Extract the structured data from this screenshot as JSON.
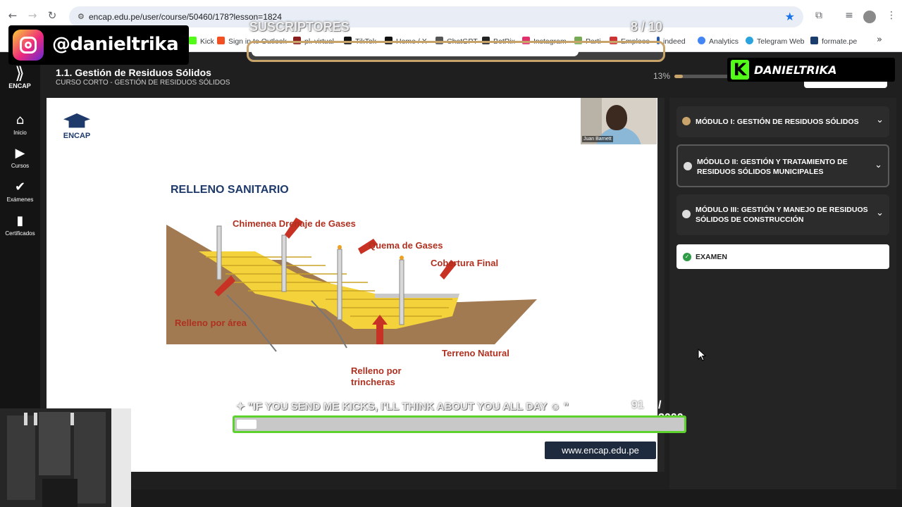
{
  "browser": {
    "url": "encap.edu.pe/user/course/50460/178?lesson=1824",
    "bookmarks": [
      "Kick",
      "Sign in to Outlook",
      "pl. virtual",
      "TikTok",
      "Home / X",
      "ChatGPT",
      "BotRix",
      "Instagram",
      "Parti",
      "Empleos",
      "indeed",
      "Analytics",
      "Telegram Web",
      "formate.pe"
    ]
  },
  "overlays": {
    "instagram_handle": "@danieltrika",
    "subs_label": "SUSCRIPTORES",
    "subs_count": "8 / 10",
    "subs_progress": 0.8,
    "kick_handle": "DANIELTRIKA",
    "kick_logo": "K",
    "goal_text": "\"IF YOU SEND ME KICKS, I'LL THINK ABOUT YOU ALL DAY",
    "goal_count": "91",
    "goal_total": "/ 2000",
    "goal_progress": 0.045
  },
  "app": {
    "brand": "ENCAP",
    "nav": [
      {
        "label": "Inicio",
        "icon": "home-icon"
      },
      {
        "label": "Cursos",
        "icon": "play-circle-icon"
      },
      {
        "label": "Exámenes",
        "icon": "check-icon"
      },
      {
        "label": "Certificados",
        "icon": "bookmark-icon"
      }
    ],
    "lesson_title": "1.1. Gestión de Residuos Sólidos",
    "course_subtitle": "CURSO CORTO - GESTIÓN DE RESIDUOS SÓLIDOS",
    "progress_label": "13%",
    "progress": 0.13
  },
  "slide": {
    "logo_text": "ENCAP",
    "presenter": "Juan Barnett",
    "title": "RELLENO SANITARIO",
    "labels": {
      "chimenea": "Chimenea Drenaje de Gases",
      "quema": "Quema de Gases",
      "cobertura": "Cobertura Final",
      "area": "Relleno por área",
      "terreno": "Terreno Natural",
      "trincheras_1": "Relleno por",
      "trincheras_2": "trincheras"
    },
    "website": "www.encap.edu.pe"
  },
  "modules": [
    {
      "title": "MÓDULO I: GESTIÓN DE RESIDUOS SÓLIDOS",
      "status": "done"
    },
    {
      "title": "MÓDULO II: GESTIÓN Y TRATAMIENTO DE RESIDUOS SÓLIDOS MUNICIPALES",
      "status": "active"
    },
    {
      "title": "MÓDULO III: GESTIÓN Y MANEJO DE RESIDUOS SÓLIDOS DE CONSTRUCCIÓN",
      "status": "pending"
    }
  ],
  "exam_label": "EXAMEN",
  "colors": {
    "accent": "#c8a46a",
    "kick_green": "#53fc18",
    "goal_border": "#5dd12e",
    "navy": "#1e3a6b"
  }
}
